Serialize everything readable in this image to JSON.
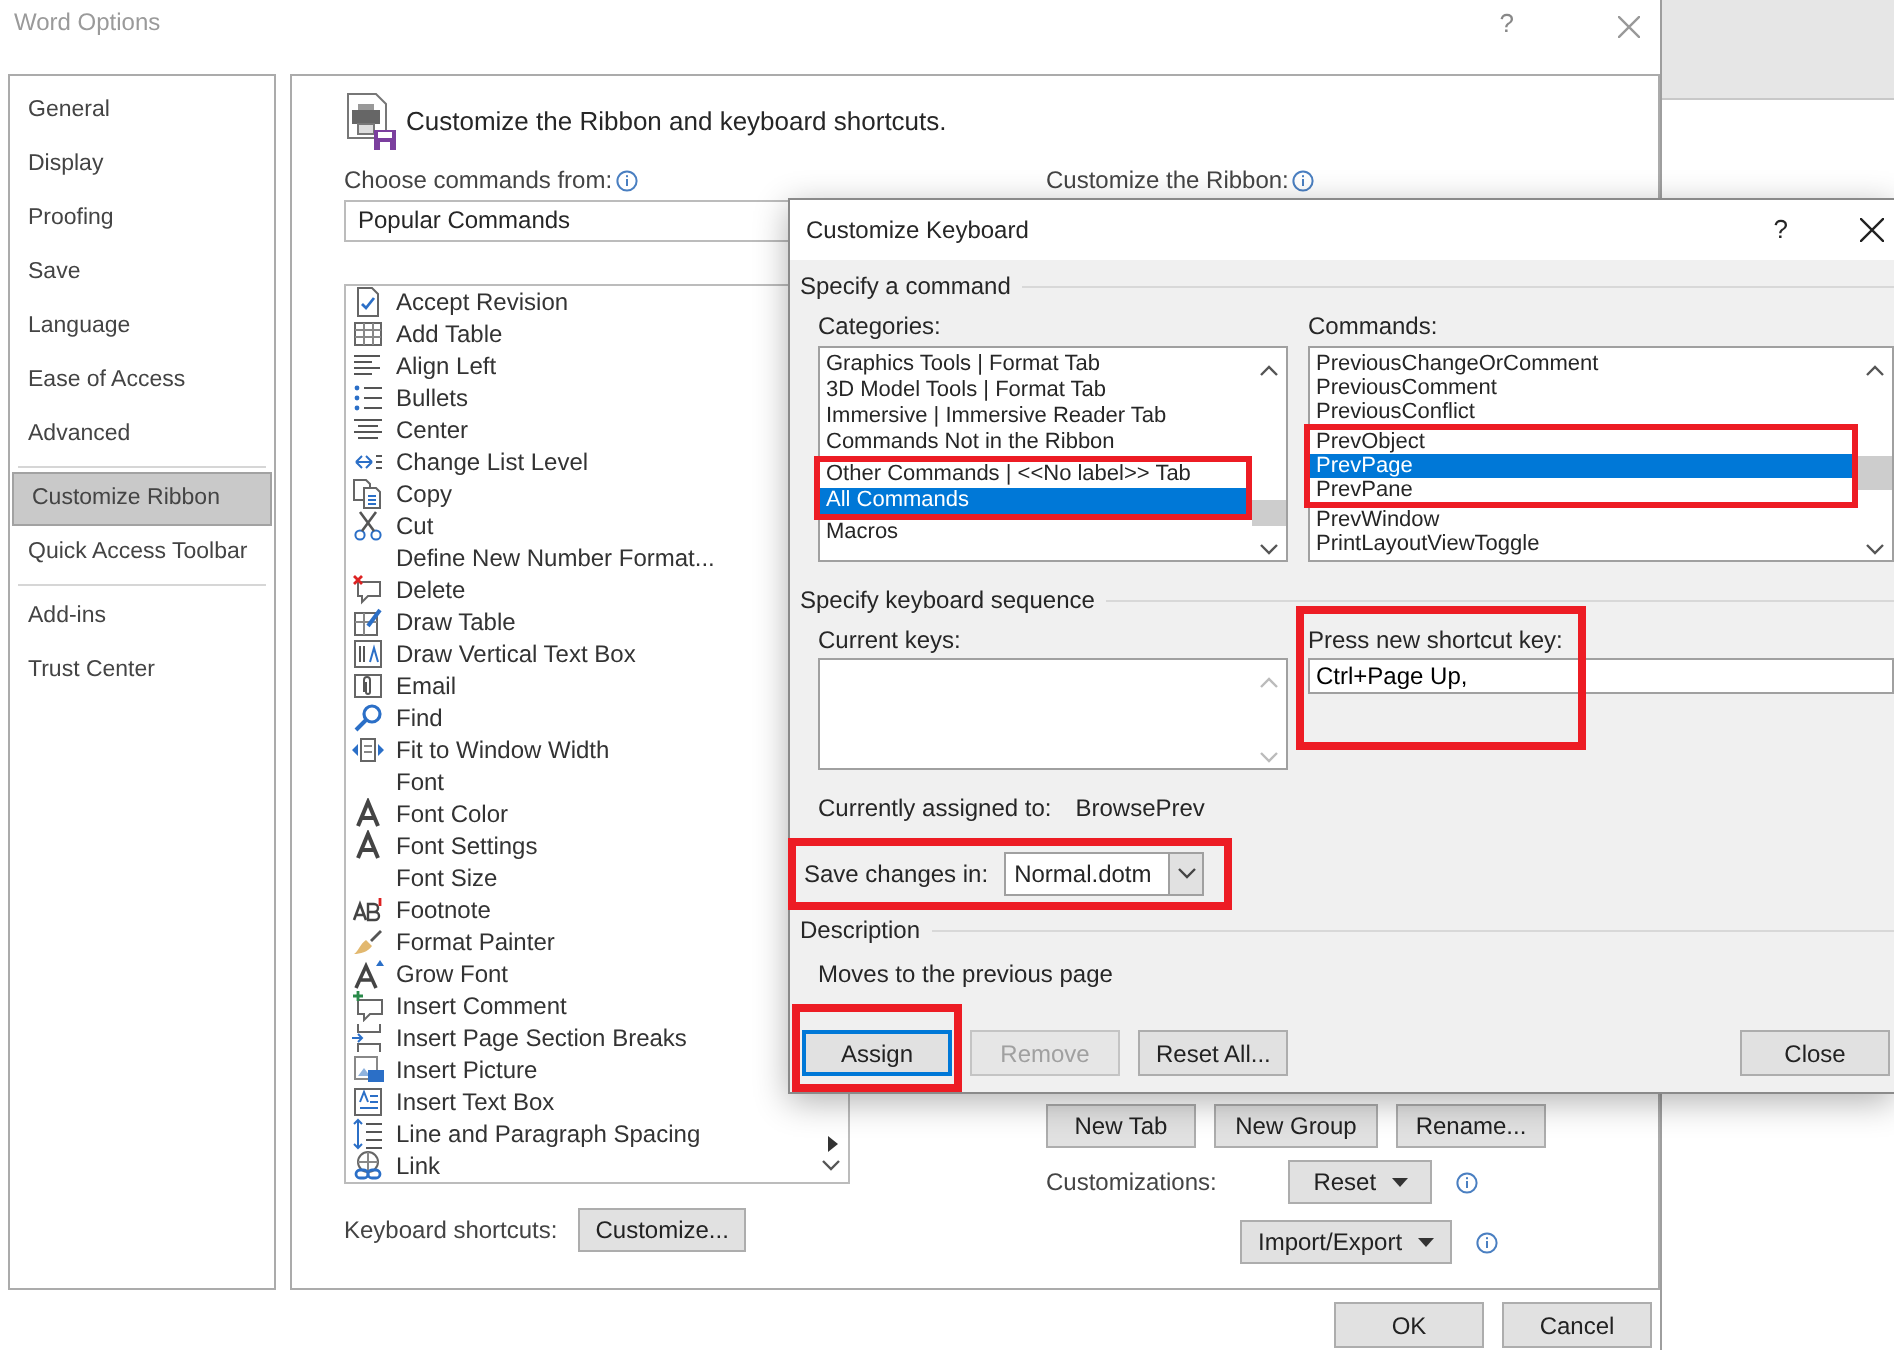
{
  "window": {
    "title": "Word Options",
    "help": "?"
  },
  "sidebar": {
    "groups": [
      [
        {
          "label": "General",
          "selected": false
        },
        {
          "label": "Display",
          "selected": false
        },
        {
          "label": "Proofing",
          "selected": false
        },
        {
          "label": "Save",
          "selected": false
        },
        {
          "label": "Language",
          "selected": false
        },
        {
          "label": "Ease of Access",
          "selected": false
        },
        {
          "label": "Advanced",
          "selected": false
        }
      ],
      [
        {
          "label": "Customize Ribbon",
          "selected": true
        },
        {
          "label": "Quick Access Toolbar",
          "selected": false
        }
      ],
      [
        {
          "label": "Add-ins",
          "selected": false
        },
        {
          "label": "Trust Center",
          "selected": false
        }
      ]
    ]
  },
  "panel": {
    "heading": "Customize the Ribbon and keyboard shortcuts.",
    "commands_from": {
      "label": "Choose commands from:",
      "value": "Popular Commands"
    },
    "commands": [
      {
        "label": "Accept Revision",
        "submenu": false
      },
      {
        "label": "Add Table",
        "submenu": false
      },
      {
        "label": "Align Left",
        "submenu": false
      },
      {
        "label": "Bullets",
        "submenu": false
      },
      {
        "label": "Center",
        "submenu": false
      },
      {
        "label": "Change List Level",
        "submenu": false
      },
      {
        "label": "Copy",
        "submenu": false
      },
      {
        "label": "Cut",
        "submenu": false
      },
      {
        "label": "Define New Number Format...",
        "submenu": false
      },
      {
        "label": "Delete",
        "submenu": false
      },
      {
        "label": "Draw Table",
        "submenu": false
      },
      {
        "label": "Draw Vertical Text Box",
        "submenu": false
      },
      {
        "label": "Email",
        "submenu": false
      },
      {
        "label": "Find",
        "submenu": false
      },
      {
        "label": "Fit to Window Width",
        "submenu": false
      },
      {
        "label": "Font",
        "submenu": false
      },
      {
        "label": "Font Color",
        "submenu": false
      },
      {
        "label": "Font Settings",
        "submenu": false
      },
      {
        "label": "Font Size",
        "submenu": false
      },
      {
        "label": "Footnote",
        "submenu": false
      },
      {
        "label": "Format Painter",
        "submenu": false
      },
      {
        "label": "Grow Font",
        "submenu": false
      },
      {
        "label": "Insert Comment",
        "submenu": false
      },
      {
        "label": "Insert Page  Section Breaks",
        "submenu": false
      },
      {
        "label": "Insert Picture",
        "submenu": false
      },
      {
        "label": "Insert Text Box",
        "submenu": false
      },
      {
        "label": "Line and Paragraph Spacing",
        "submenu": true
      },
      {
        "label": "Link",
        "submenu": false
      }
    ],
    "keyboard_shortcuts": {
      "label": "Keyboard shortcuts:",
      "button": "Customize..."
    },
    "ribbon_label": "Customize the Ribbon:",
    "ribbon_buttons": [
      "New Tab",
      "New Group",
      "Rename..."
    ],
    "customizations": {
      "label": "Customizations:",
      "reset": "Reset",
      "import_export": "Import/Export"
    }
  },
  "footer_buttons": [
    "OK",
    "Cancel"
  ],
  "dialog": {
    "title": "Customize Keyboard",
    "help": "?",
    "command_section": "Specify a command",
    "categories": {
      "label": "Categories:",
      "highlighted": true,
      "items": [
        {
          "label": "Graphics Tools | Format Tab",
          "selected": false
        },
        {
          "label": "3D Model Tools | Format Tab",
          "selected": false
        },
        {
          "label": "Immersive | Immersive Reader Tab",
          "selected": false
        },
        {
          "label": "Commands Not in the Ribbon",
          "selected": false
        },
        {
          "label": "Other Commands | <<No label>> Tab",
          "selected": false
        },
        {
          "label": "All Commands",
          "selected": true
        },
        {
          "label": "Macros",
          "selected": false
        }
      ]
    },
    "commands": {
      "label": "Commands:",
      "highlighted": true,
      "items": [
        {
          "label": "PreviousChangeOrComment",
          "selected": false
        },
        {
          "label": "PreviousComment",
          "selected": false
        },
        {
          "label": "PreviousConflict",
          "selected": false
        },
        {
          "label": "PrevObject",
          "selected": false
        },
        {
          "label": "PrevPage",
          "selected": true
        },
        {
          "label": "PrevPane",
          "selected": false
        },
        {
          "label": "PrevWindow",
          "selected": false
        },
        {
          "label": "PrintLayoutViewToggle",
          "selected": false
        }
      ]
    },
    "sequence_section": "Specify keyboard sequence",
    "current_keys": {
      "label": "Current keys:"
    },
    "new_key": {
      "label": "Press new shortcut key:",
      "value": "Ctrl+Page Up,",
      "highlighted": true
    },
    "assigned": {
      "label": "Currently assigned to:",
      "value": "BrowsePrev"
    },
    "save_in": {
      "label": "Save changes in:",
      "value": "Normal.dotm",
      "highlighted": true
    },
    "description": {
      "label": "Description",
      "text": "Moves to the previous page"
    },
    "buttons": [
      {
        "label": "Assign",
        "disabled": false,
        "focused": true,
        "highlighted": true
      },
      {
        "label": "Remove",
        "disabled": true,
        "focused": false,
        "highlighted": false
      },
      {
        "label": "Reset All...",
        "disabled": false,
        "focused": false,
        "highlighted": false
      },
      {
        "label": "Close",
        "disabled": false,
        "focused": false,
        "highlighted": false
      }
    ]
  }
}
